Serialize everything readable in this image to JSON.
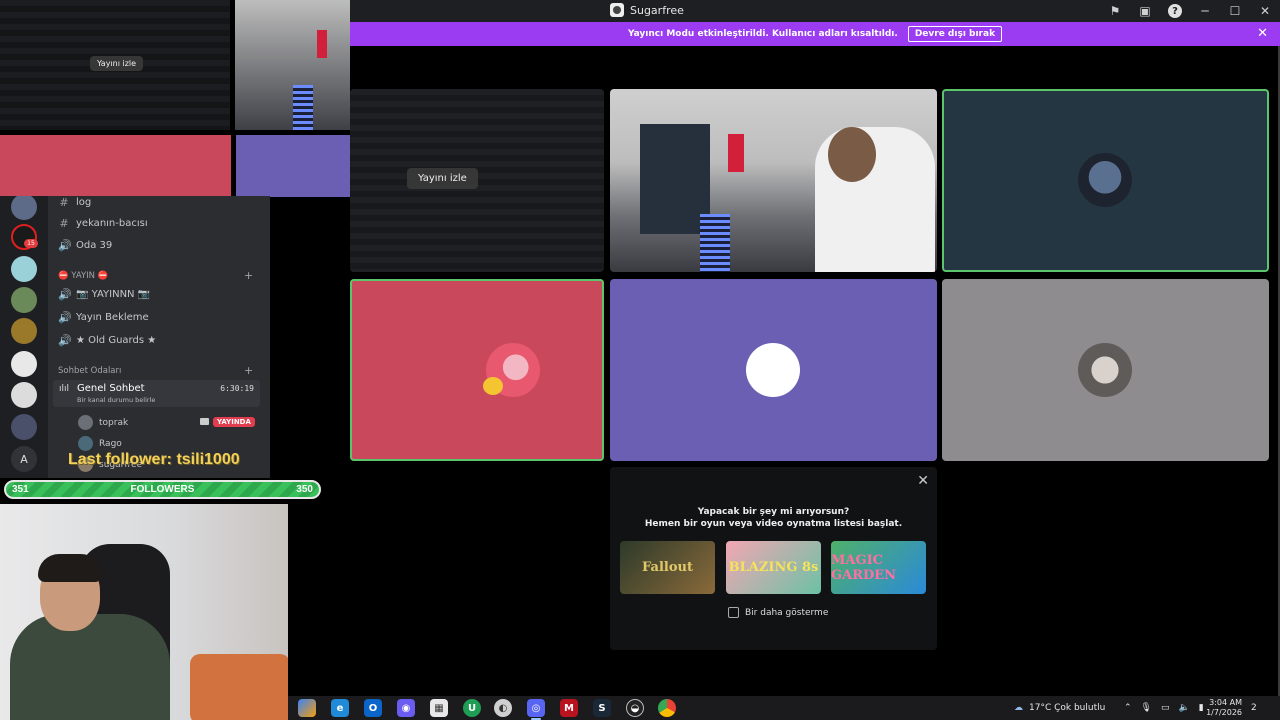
{
  "window": {
    "title": "Sugarfree",
    "banner_text": "Yayıncı Modu etkinleştirildi. Kullanıcı adları kısaltıldı.",
    "banner_button": "Devre dışı bırak",
    "watch_stream": "Yayını izle"
  },
  "activity": {
    "line1": "Yapacak bir şey mi arıyorsun?",
    "line2": "Hemen bir oyun veya video oynatma listesi başlat.",
    "games": [
      "Fallout",
      "BLAZING 8s",
      "MAGIC GARDEN"
    ],
    "dont_show": "Bir daha gösterme"
  },
  "overlay": {
    "watch_stream": "Yayını izle",
    "last_follower": "Last follower: tsili1000",
    "followers_left": "351",
    "followers_label": "FOLLOWERS",
    "followers_right": "350"
  },
  "sidebar": {
    "server_badge": "15",
    "server_letter": "A",
    "channels_top": [
      {
        "sym": "#",
        "name": "log"
      },
      {
        "sym": "#",
        "name": "yekanın-bacısı"
      },
      {
        "sym": "🔊",
        "name": "Oda 39"
      }
    ],
    "category1": "⛔ YAYIN ⛔",
    "channels_yayin": [
      {
        "sym": "🔊",
        "name": "📷 YAYINNN 📷"
      },
      {
        "sym": "🔊",
        "name": "Yayın Bekleme"
      },
      {
        "sym": "🔊",
        "name": "★ Old Guards ★"
      }
    ],
    "category2": "Sohbet Odaları",
    "genel": {
      "name": "Genel Sohbet",
      "time": "6:30:19",
      "status": "Bir kanal durumu belirle"
    },
    "members": [
      "toprak",
      "Rago",
      "sugarfree"
    ],
    "live_badge": "YAYINDA"
  },
  "taskbar": {
    "weather": "17°C  Çok bulutlu",
    "time": "3:04 AM",
    "date": "1/7/2026",
    "notif": "2"
  }
}
